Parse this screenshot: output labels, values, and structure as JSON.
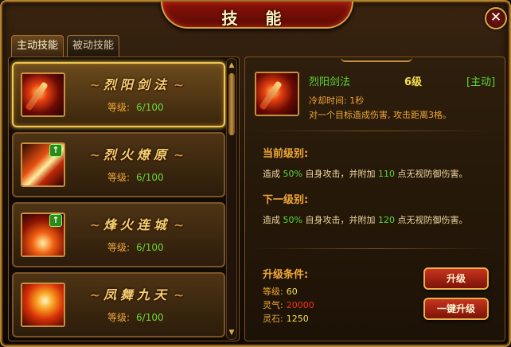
{
  "window": {
    "title": "技 能",
    "close_symbol": "✕"
  },
  "tabs": [
    {
      "label": "主动技能",
      "active": true
    },
    {
      "label": "被动技能",
      "active": false
    }
  ],
  "skills": [
    {
      "name": "烈阳剑法",
      "level_label": "等级:",
      "level_value": "6/100",
      "icon": "sword-fire-icon",
      "upgradable": false,
      "selected": true
    },
    {
      "name": "烈火燎原",
      "level_label": "等级:",
      "level_value": "6/100",
      "icon": "flame-slash-icon",
      "upgradable": true,
      "selected": false
    },
    {
      "name": "烽火连城",
      "level_label": "等级:",
      "level_value": "6/100",
      "icon": "fire-wall-icon",
      "upgradable": true,
      "selected": false
    },
    {
      "name": "凤舞九天",
      "level_label": "等级:",
      "level_value": "6/100",
      "icon": "phoenix-icon",
      "upgradable": false,
      "selected": false
    }
  ],
  "detail": {
    "name": "烈阳剑法",
    "level": "6级",
    "type": "[主动]",
    "cooldown": "冷却时间: 1秒",
    "description": "对一个目标造成伤害, 攻击距离3格。",
    "current_title": "当前级别:",
    "current_text": {
      "pre": "造成",
      "pct": "50%",
      "mid": "自身攻击，并附加",
      "val": "110",
      "post": "点无视防御伤害。"
    },
    "next_title": "下一级别:",
    "next_text": {
      "pre": "造成",
      "pct": "50%",
      "mid": "自身攻击，并附加",
      "val": "120",
      "post": "点无视防御伤害。"
    },
    "req_title": "升级条件:",
    "requirements": [
      {
        "label": "等级:",
        "value": "60"
      },
      {
        "label": "灵气:",
        "value": "20000"
      },
      {
        "label": "灵石:",
        "value": "1250"
      }
    ],
    "upgrade_label": "升级",
    "one_key_upgrade_label": "一键升级"
  },
  "colors": {
    "accent_gold": "#f0c850",
    "green": "#5ad838",
    "red": "#ff3018",
    "orange": "#f0a838"
  }
}
